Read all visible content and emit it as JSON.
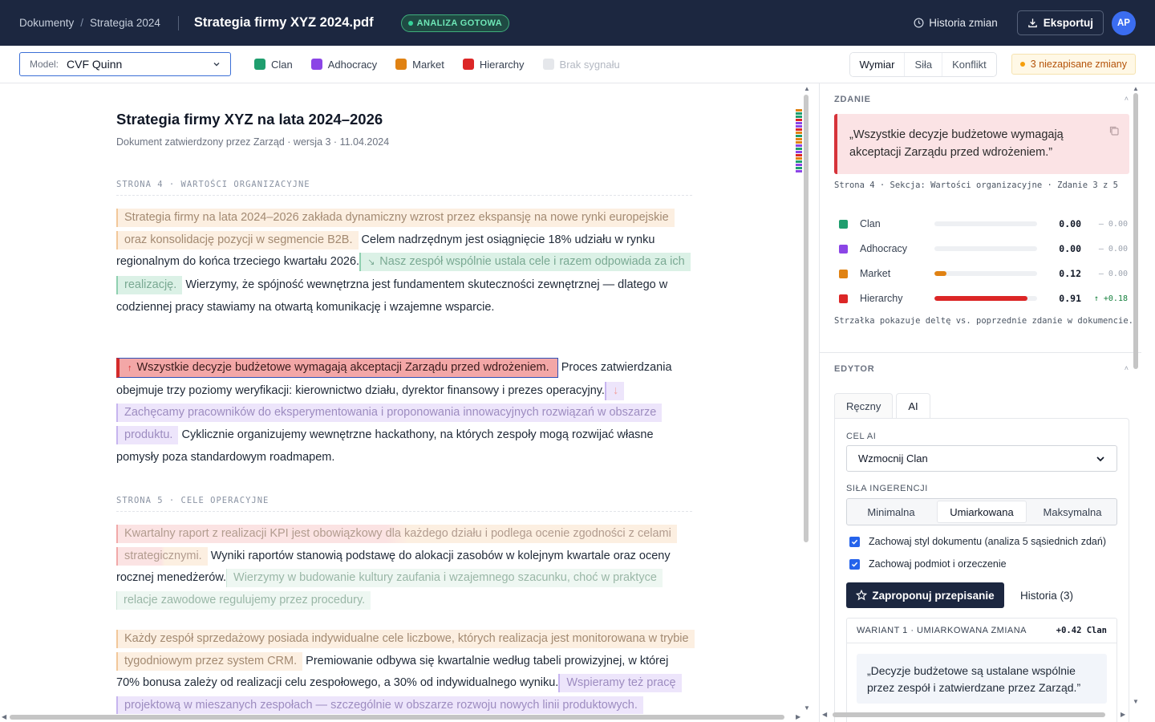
{
  "topbar": {
    "breadcrumb": [
      "Dokumenty",
      "Strategia 2024"
    ],
    "breadcrumb_sep": "/",
    "document_title": "Strategia firmy XYZ 2024.pdf",
    "status_badge": "ANALIZA GOTOWA",
    "history_label": "Historia zmian",
    "export_label": "Eksportuj",
    "avatar_initials": "AP"
  },
  "toolbar": {
    "model_label": "Model:",
    "model_value": "CVF Quinn",
    "legend": [
      {
        "label": "Clan",
        "color": "#1f9e6e"
      },
      {
        "label": "Adhocracy",
        "color": "#8b45e6"
      },
      {
        "label": "Market",
        "color": "#e08213"
      },
      {
        "label": "Hierarchy",
        "color": "#dc2626"
      },
      {
        "label": "Brak sygnału",
        "color": "#e5e7eb"
      }
    ],
    "view_modes": [
      "Wymiar",
      "Siła",
      "Konflikt"
    ],
    "active_view": "Wymiar",
    "unsaved": "3 niezapisane zmiany"
  },
  "document": {
    "title": "Strategia firmy XYZ na lata 2024–2026",
    "subtitle": "Dokument zatwierdzony przez Zarząd · wersja 3 · 11.04.2024",
    "section_page4": "STRONA 4 · WARTOŚCI ORGANIZACYJNE",
    "section_page5": "STRONA 5 · CELE OPERACYJNE",
    "p1": {
      "s1": "Strategia firmy na lata 2024–2026 zakłada dynamiczny wzrost przez ekspansję na nowe rynki europejskie oraz konsolidację pozycji w segmencie B2B.",
      "s2": "Celem nadrzędnym jest osiągnięcie 18% udziału w rynku regionalnym do końca trzeciego kwartału 2026.",
      "s3": "Nasz zespół wspólnie ustala cele i razem odpowiada za ich realizację.",
      "s3_arrow": "↘",
      "s4": "Wierzymy, że spójność wewnętrzna jest fundamentem skuteczności zewnętrznej — dlatego w codziennej pracy stawiamy na otwartą komunikację i wzajemne wsparcie."
    },
    "p2": {
      "s1": "Wszystkie decyzje budżetowe wymagają akceptacji Zarządu przed wdrożeniem.",
      "s1_arrow": "↑",
      "s2": "Proces zatwierdzania obejmuje trzy poziomy weryfikacji: kierownictwo działu, dyrektor finansowy i prezes operacyjny.",
      "s2_arrow": "↓",
      "s3": "Zachęcamy pracowników do eksperymentowania i proponowania innowacyjnych rozwiązań w obszarze produktu.",
      "s4": "Cyklicznie organizujemy wewnętrzne hackathony, na których zespoły mogą rozwijać własne pomysły poza standardowym roadmapem."
    },
    "p3": {
      "s1": "Kwartalny raport z realizacji KPI jest obowiązkowy dla każdego działu i podlega ocenie zgodności z celami strategicznymi.",
      "s2": "Wyniki raportów stanowią podstawę do alokacji zasobów w kolejnym kwartale oraz oceny rocznej menedżerów.",
      "s3": "Wierzymy w budowanie kultury zaufania i wzajemnego szacunku, choć w praktyce relacje zawodowe regulujemy przez procedury."
    },
    "p4": {
      "s1": "Każdy zespół sprzedażowy posiada indywidualne cele liczbowe, których realizacja jest monitorowana w trybie tygodniowym przez system CRM.",
      "s2": "Premiowanie odbywa się kwartalnie według tabeli prowizyjnej, w której 70% bonusa zależy od realizacji celu zespołowego, a 30% od indywidualnego wyniku.",
      "s3": "Wspieramy też pracę projektową w mieszanych zespołach — szczególnie w obszarze rozwoju nowych linii produktowych."
    }
  },
  "panel": {
    "sentence_header": "ZDANIE",
    "sentence_quote": "„Wszystkie decyzje budżetowe wymagają akceptacji Zarządu przed wdrożeniem.”",
    "sentence_meta": "Strona 4 · Sekcja: Wartości organizacyjne · Zdanie 3 z 5",
    "scores": [
      {
        "name": "Clan",
        "color": "#1f9e6e",
        "value": "0.00",
        "fraction": 0.0,
        "delta": "— 0.00",
        "up": false
      },
      {
        "name": "Adhocracy",
        "color": "#8b45e6",
        "value": "0.00",
        "fraction": 0.0,
        "delta": "— 0.00",
        "up": false
      },
      {
        "name": "Market",
        "color": "#e08213",
        "value": "0.12",
        "fraction": 0.12,
        "delta": "— 0.00",
        "up": false
      },
      {
        "name": "Hierarchy",
        "color": "#dc2626",
        "value": "0.91",
        "fraction": 0.91,
        "delta": "↑ +0.18",
        "up": true
      }
    ],
    "delta_note": "Strzałka pokazuje deltę vs. poprzednie zdanie w dokumencie.",
    "editor_header": "EDYTOR",
    "editor_tabs": [
      "Ręczny",
      "AI"
    ],
    "active_tab": "AI",
    "ai_goal_label": "CEL AI",
    "ai_goal_value": "Wzmocnij Clan",
    "strength_label": "SIŁA INGERENCJI",
    "strength_options": [
      "Minimalna",
      "Umiarkowana",
      "Maksymalna"
    ],
    "active_strength": "Umiarkowana",
    "checkbox_style": "Zachowaj styl dokumentu (analiza 5 sąsiednich zdań)",
    "checkbox_subject": "Zachowaj podmiot i orzeczenie",
    "propose_label": "Zaproponuj przepisanie",
    "history_link": "Historia (3)",
    "variant_title": "WARIANT 1 · UMIARKOWANA ZMIANA",
    "variant_score": "+0.42 Clan",
    "variant_quote": "„Decyzje budżetowe są ustalane wspólnie przez zespół i zatwierdzane przez Zarząd.”"
  },
  "minimap_colors": [
    "#e08213",
    "#1f9e6e",
    "#1f9e6e",
    "#dc2626",
    "#8b45e6",
    "#8b45e6",
    "#dc2626",
    "#e08213",
    "#1f9e6e",
    "#e08213",
    "#e08213",
    "#8b45e6",
    "#1f9e6e",
    "#8b45e6",
    "#dc2626",
    "#e08213",
    "#1f9e6e",
    "#8b45e6",
    "#1f9e6e",
    "#8b45e6"
  ]
}
